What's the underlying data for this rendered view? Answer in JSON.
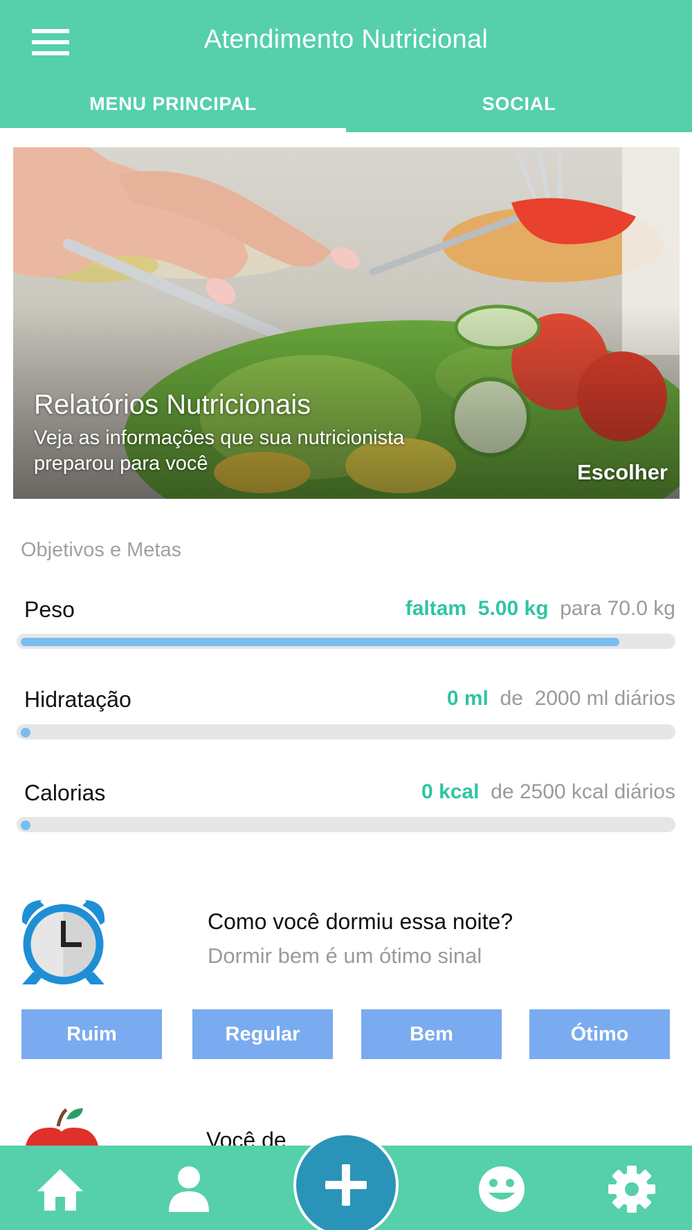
{
  "header": {
    "title": "Atendimento Nutricional",
    "tabs": [
      "MENU PRINCIPAL",
      "SOCIAL"
    ],
    "active_tab": "MENU PRINCIPAL"
  },
  "hero": {
    "title": "Relatórios Nutricionais",
    "subtitle": "Veja as informações que sua nutricionista preparou para você",
    "cta": "Escolher"
  },
  "goals": {
    "section_label": "Objetivos e Metas",
    "peso": {
      "label": "Peso",
      "prefix": "faltam",
      "value": "5.00 kg",
      "suffix": "para",
      "target": "70.0 kg",
      "progress_fraction": 0.92
    },
    "hidratacao": {
      "label": "Hidratação",
      "value": "0 ml",
      "suffix": "de",
      "target": "2000 ml diários",
      "progress_fraction": 0
    },
    "calorias": {
      "label": "Calorias",
      "value": "0 kcal",
      "suffix": "de",
      "target": "2500 kcal diários",
      "progress_fraction": 0
    }
  },
  "sleep": {
    "question": "Como você dormiu essa noite?",
    "subtitle": "Dormir bem é um ótimo sinal",
    "options": [
      "Ruim",
      "Regular",
      "Bem",
      "Ótimo"
    ]
  },
  "next_section": {
    "partial_text": "Você de"
  },
  "bottom_nav": {
    "items": [
      "home-icon",
      "profile-icon",
      "add-icon",
      "smiley-icon",
      "settings-icon"
    ]
  },
  "colors": {
    "primary": "#55d0aa",
    "accent_text": "#2fc5a1",
    "progress": "#79bdf0",
    "rating_button": "#7aabf0",
    "fab": "#2a93b8"
  }
}
